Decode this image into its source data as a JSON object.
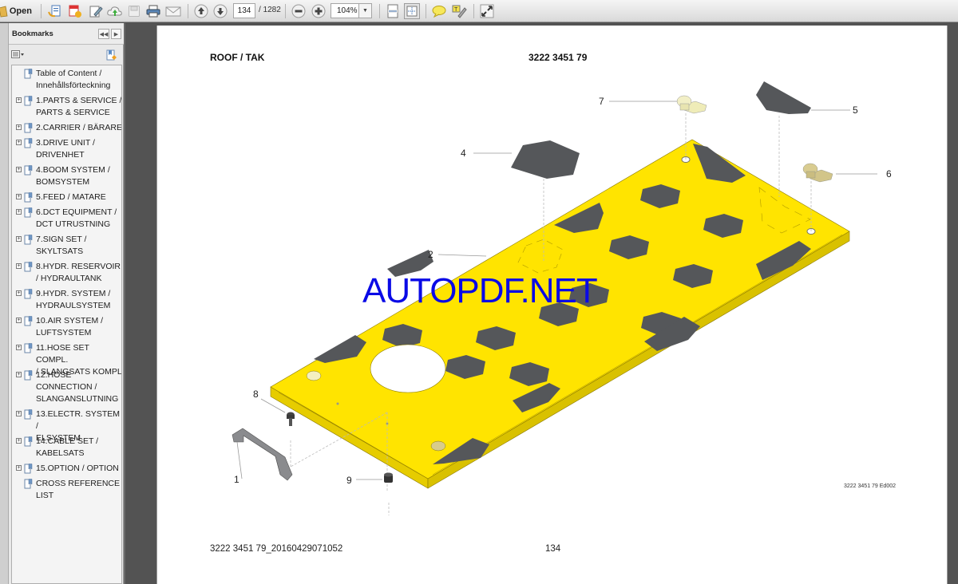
{
  "toolbar": {
    "open_label": "Open",
    "current_page": "134",
    "page_total": "/ 1282",
    "zoom_value": "104%",
    "icons": [
      "open-folder-icon",
      "create-pdf-icon",
      "export-pdf-icon",
      "edit-pdf-icon",
      "cloud-upload-icon",
      "save-icon",
      "print-icon",
      "email-icon",
      "previous-page-icon",
      "next-page-icon",
      "zoom-out-icon",
      "zoom-in-icon",
      "fit-width-icon",
      "fit-page-icon",
      "comment-icon",
      "highlight-icon",
      "fullscreen-icon"
    ]
  },
  "bookmarks": {
    "title": "Bookmarks",
    "items": [
      {
        "label": "Table of Content /\nInnehållsförteckning",
        "expandable": false
      },
      {
        "label": "1.PARTS & SERVICE /\nPARTS & SERVICE",
        "expandable": true
      },
      {
        "label": "2.CARRIER / BÄRARE",
        "expandable": true
      },
      {
        "label": "3.DRIVE UNIT /\nDRIVENHET",
        "expandable": true
      },
      {
        "label": "4.BOOM SYSTEM /\nBOMSYSTEM",
        "expandable": true
      },
      {
        "label": "5.FEED / MATARE",
        "expandable": true
      },
      {
        "label": "6.DCT EQUIPMENT /\nDCT UTRUSTNING",
        "expandable": true
      },
      {
        "label": "7.SIGN SET /\nSKYLTSATS",
        "expandable": true
      },
      {
        "label": "8.HYDR. RESERVOIR\n/ HYDRAULTANK",
        "expandable": true
      },
      {
        "label": "9.HYDR. SYSTEM /\nHYDRAULSYSTEM",
        "expandable": true
      },
      {
        "label": "10.AIR SYSTEM /\nLUFTSYSTEM",
        "expandable": true
      },
      {
        "label": "11.HOSE SET COMPL.\n/ SLANGSATS KOMPL",
        "expandable": true
      },
      {
        "label": "12.HOSE\nCONNECTION /\nSLANGANSLUTNING",
        "expandable": true
      },
      {
        "label": "13.ELECTR. SYSTEM /\nELSYSTEM",
        "expandable": true
      },
      {
        "label": "14.CABLE SET /\nKABELSATS",
        "expandable": true
      },
      {
        "label": "15.OPTION / OPTION",
        "expandable": true
      },
      {
        "label": "CROSS REFERENCE\nLIST",
        "expandable": false
      }
    ]
  },
  "page": {
    "title": "ROOF / TAK",
    "part_number": "3222 3451 79",
    "edition": "3222 3451 79 Ed002",
    "footer_doc": "3222 3451 79_20160429071052",
    "footer_page": "134",
    "watermark": "AUTOPDF.NET",
    "callouts": [
      "1",
      "2",
      "4",
      "5",
      "6",
      "7",
      "8",
      "9"
    ]
  },
  "colors": {
    "plate_yellow": "#ffe400",
    "pad_gray": "#55575a",
    "watermark_blue": "#0a0ae6",
    "viewer_bg": "#535353"
  }
}
